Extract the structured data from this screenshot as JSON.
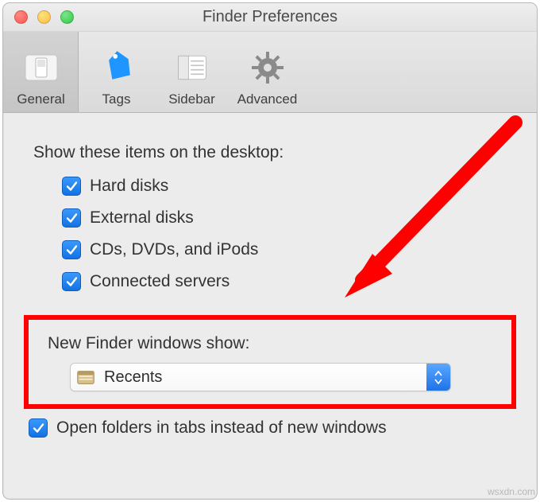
{
  "window": {
    "title": "Finder Preferences"
  },
  "toolbar": {
    "items": [
      {
        "label": "General",
        "selected": true
      },
      {
        "label": "Tags",
        "selected": false
      },
      {
        "label": "Sidebar",
        "selected": false
      },
      {
        "label": "Advanced",
        "selected": false
      }
    ]
  },
  "desktop_section": {
    "heading": "Show these items on the desktop:",
    "items": [
      {
        "label": "Hard disks",
        "checked": true
      },
      {
        "label": "External disks",
        "checked": true
      },
      {
        "label": "CDs, DVDs, and iPods",
        "checked": true
      },
      {
        "label": "Connected servers",
        "checked": true
      }
    ]
  },
  "new_windows": {
    "label": "New Finder windows show:",
    "selected": "Recents"
  },
  "tabs_option": {
    "label": "Open folders in tabs instead of new windows",
    "checked": true
  },
  "watermark": "wsxdn.com"
}
